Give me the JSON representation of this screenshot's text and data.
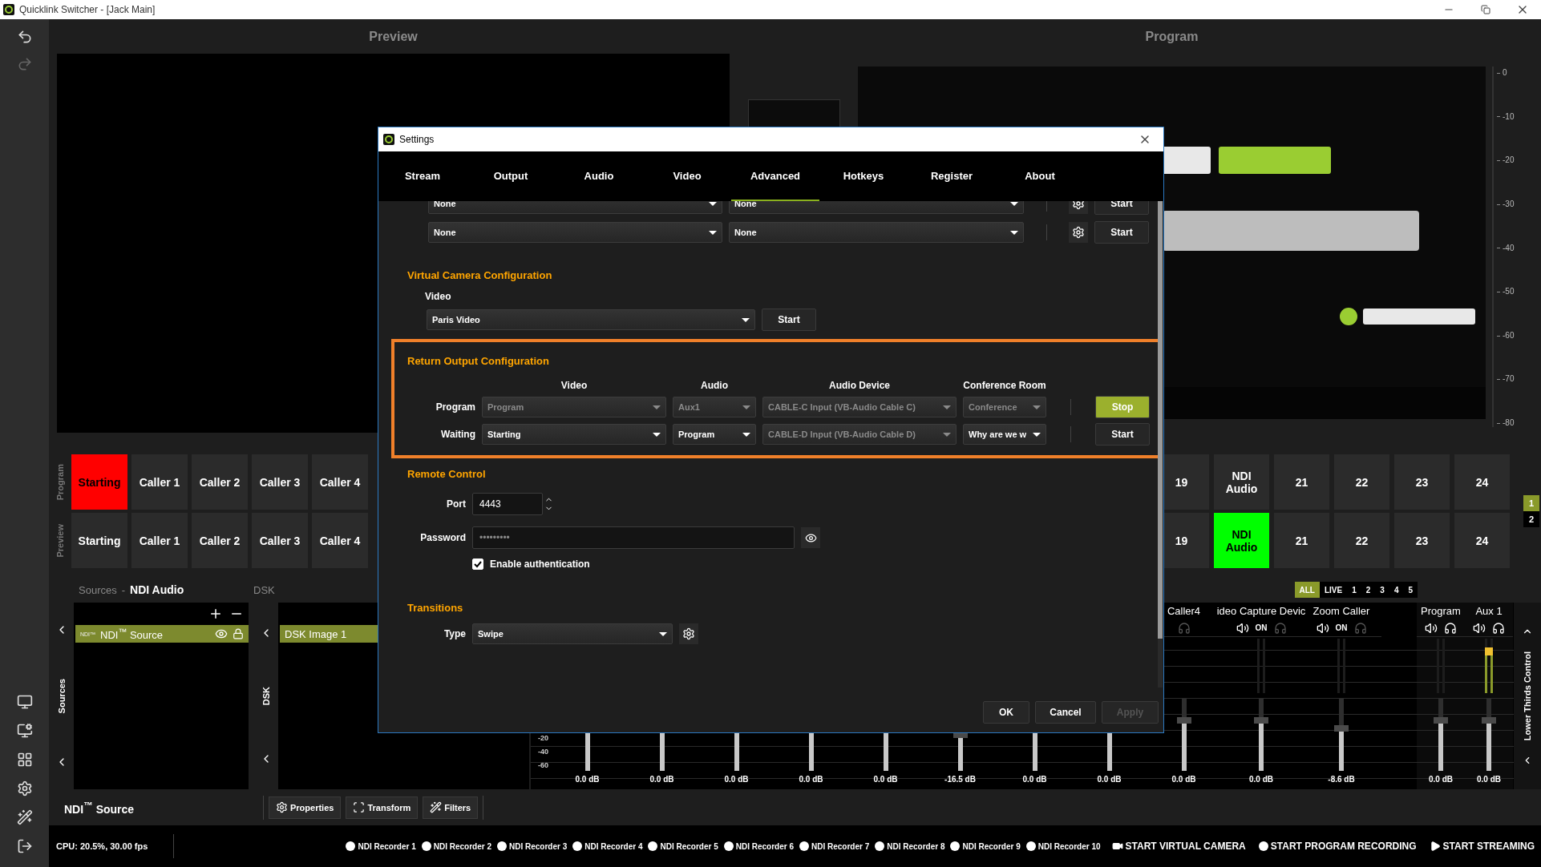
{
  "window": {
    "title": "Quicklink Switcher - [Jack Main]"
  },
  "sidebar": {
    "top": [
      {
        "kind": "undo",
        "disabled": false
      },
      {
        "kind": "redo",
        "disabled": true
      }
    ],
    "bottom": [
      {
        "kind": "display"
      },
      {
        "kind": "display-search"
      },
      {
        "kind": "layout"
      },
      {
        "kind": "settings"
      },
      {
        "kind": "tools"
      },
      {
        "kind": "exit"
      }
    ]
  },
  "monitors": {
    "preview": {
      "title": "Preview"
    },
    "program": {
      "title": "Program",
      "frame": {
        "kind": "picture"
      },
      "scale": [
        "0",
        "-10",
        "-20",
        "-30",
        "-40",
        "-50",
        "-60",
        "-70",
        "-80"
      ]
    }
  },
  "scenes": {
    "rows": [
      {
        "kind": "program",
        "label": "Program",
        "left": [
          {
            "label": "Starting",
            "selected": true
          },
          {
            "label": "Caller 1",
            "selected": false
          },
          {
            "label": "Caller 2",
            "selected": false
          },
          {
            "label": "Caller 3",
            "selected": false
          },
          {
            "label": "Caller 4",
            "selected": false
          }
        ],
        "right": [
          {
            "label": "19",
            "selected": false
          },
          {
            "label": "NDI Audio",
            "selected": false
          },
          {
            "label": "21",
            "selected": false
          },
          {
            "label": "22",
            "selected": false
          },
          {
            "label": "23",
            "selected": false
          },
          {
            "label": "24",
            "selected": false
          }
        ]
      },
      {
        "kind": "preview",
        "label": "Preview",
        "left": [
          {
            "label": "Starting",
            "selected": false
          },
          {
            "label": "Caller 1",
            "selected": false
          },
          {
            "label": "Caller 2",
            "selected": false
          },
          {
            "label": "Caller 3",
            "selected": false
          },
          {
            "label": "Caller 4",
            "selected": false
          }
        ],
        "right": [
          {
            "label": "19",
            "selected": false
          },
          {
            "label": "NDI Audio",
            "selected": true
          },
          {
            "label": "21",
            "selected": false
          },
          {
            "label": "22",
            "selected": false
          },
          {
            "label": "23",
            "selected": false
          },
          {
            "label": "24",
            "selected": false
          }
        ]
      }
    ],
    "pages": [
      {
        "label": "1",
        "selected": true
      },
      {
        "label": "2",
        "selected": false
      }
    ]
  },
  "sources": {
    "header": "Sources",
    "separator": "-",
    "current": "NDI Audio",
    "tab": "Sources",
    "items": [
      {
        "badge": "NDI™",
        "label": "NDI$^{™}$ Source",
        "selected": true
      }
    ]
  },
  "dsk": {
    "header": "DSK",
    "tab": "DSK",
    "items": [
      {
        "label": "DSK Image 1",
        "selected": true
      }
    ]
  },
  "mixer": {
    "filters": [
      {
        "label": "ALL",
        "selected": true
      },
      {
        "label": "LIVE",
        "selected": false
      },
      {
        "label": "1",
        "selected": false
      },
      {
        "label": "2",
        "selected": false
      },
      {
        "label": "3",
        "selected": false
      },
      {
        "label": "4",
        "selected": false
      },
      {
        "label": "5",
        "selected": false
      }
    ],
    "scale": [
      "-20",
      "-40",
      "-60"
    ],
    "channels": [
      {
        "reading": "0.0 dB",
        "fader": {
          "level": 0.74
        }
      },
      {
        "reading": "0.0 dB",
        "fader": {
          "level": 0.74
        }
      },
      {
        "reading": "0.0 dB",
        "fader": {
          "level": 0.74
        }
      },
      {
        "reading": "0.0 dB",
        "fader": {
          "level": 0.74
        }
      },
      {
        "reading": "0.0 dB",
        "fader": {
          "level": 0.74
        }
      },
      {
        "reading": "-16.5 dB",
        "fader": {
          "level": 0.55
        }
      },
      {
        "reading": "0.0 dB",
        "fader": {
          "level": 0.74
        }
      },
      {
        "reading": "0.0 dB",
        "fader": {
          "level": 0.74
        }
      },
      {
        "name": "Caller4",
        "controls": [
          {
            "kind": "headphones",
            "on": false
          }
        ],
        "reading": "0.0 dB",
        "fader": {
          "level": 0.74
        }
      },
      {
        "name": "ideo Capture Devic",
        "controls": [
          {
            "kind": "speaker"
          },
          {
            "kind": "status",
            "label": "ON"
          },
          {
            "kind": "headphones",
            "on": false
          }
        ],
        "reading": "0.0 dB",
        "fader": {
          "level": 0.74
        }
      },
      {
        "name": "Zoom Caller",
        "controls": [
          {
            "kind": "speaker"
          },
          {
            "kind": "status",
            "label": "ON"
          },
          {
            "kind": "headphones",
            "on": false
          }
        ],
        "reading": "-8.6 dB",
        "fader": {
          "level": 0.63
        }
      }
    ],
    "masters": [
      {
        "name": "Program",
        "controls": [
          {
            "kind": "speaker"
          },
          {
            "kind": "headphones",
            "on": true
          }
        ],
        "reading": "0.0 dB",
        "fader": {
          "level": 0.74
        }
      },
      {
        "name": "Aux 1",
        "controls": [
          {
            "kind": "speaker"
          },
          {
            "kind": "headphones",
            "on": true
          }
        ],
        "meter": {
          "level": 0.84
        },
        "reading": "0.0 dB",
        "fader": {
          "level": 0.74
        }
      }
    ]
  },
  "lower_thirds": {
    "label": "Lower Thirds Control"
  },
  "source_toolbar": {
    "source": "NDI$^{™}$ Source",
    "buttons": [
      {
        "label": "Properties",
        "kind": "gear"
      },
      {
        "label": "Transform",
        "kind": "transform"
      },
      {
        "label": "Filters",
        "kind": "wand"
      }
    ]
  },
  "status_bar": {
    "cpu": "CPU: 20.5%, 30.00 fps",
    "recorders": [
      "NDI Recorder 1",
      "NDI Recorder 2",
      "NDI Recorder 3",
      "NDI Recorder 4",
      "NDI Recorder 5",
      "NDI Recorder 6",
      "NDI Recorder 7",
      "NDI Recorder 8",
      "NDI Recorder 9",
      "NDI Recorder 10"
    ],
    "actions": [
      {
        "label": "START VIRTUAL CAMERA",
        "kind": "camera"
      },
      {
        "label": "START PROGRAM RECORDING",
        "kind": "record"
      },
      {
        "label": "START STREAMING",
        "kind": "stream"
      }
    ]
  },
  "settings": {
    "title": "Settings",
    "tabs": [
      {
        "label": "Stream",
        "selected": false
      },
      {
        "label": "Output",
        "selected": false
      },
      {
        "label": "Audio",
        "selected": false
      },
      {
        "label": "Video",
        "selected": false
      },
      {
        "label": "Advanced",
        "selected": true
      },
      {
        "label": "Hotkeys",
        "selected": false
      },
      {
        "label": "Register",
        "selected": false
      },
      {
        "label": "About",
        "selected": false
      }
    ],
    "output_rows": [
      {
        "source": "None",
        "target": "None",
        "button": "Start"
      },
      {
        "source": "None",
        "target": "None",
        "button": "Start"
      }
    ],
    "virtual_camera": {
      "heading": "Virtual Camera Configuration",
      "label": "Video",
      "value": "Paris Video",
      "button": "Start"
    },
    "return_output": {
      "heading": "Return Output Configuration",
      "highlighted": true,
      "columns": [
        "Video",
        "Audio",
        "Audio Device",
        "Conference Room"
      ],
      "rows": [
        {
          "label": "Program",
          "cells": [
            {
              "value": "Program",
              "disabled": true
            },
            {
              "value": "Aux1",
              "disabled": true
            },
            {
              "value": "CABLE-C Input (VB-Audio Cable C)",
              "disabled": true
            },
            {
              "value": "Conference",
              "disabled": true
            }
          ],
          "button": {
            "label": "Stop",
            "active": true
          }
        },
        {
          "label": "Waiting",
          "cells": [
            {
              "value": "Starting",
              "disabled": false
            },
            {
              "value": "Program",
              "disabled": false
            },
            {
              "value": "CABLE-D Input (VB-Audio Cable D)",
              "disabled": true
            },
            {
              "value": "Why are we w",
              "disabled": false
            }
          ],
          "button": {
            "label": "Start",
            "active": false
          }
        }
      ]
    },
    "remote_control": {
      "heading": "Remote Control",
      "port_label": "Port",
      "port": "4443",
      "password_label": "Password",
      "password": "•••••••••",
      "auth": {
        "label": "Enable authentication",
        "checked": true
      }
    },
    "transitions": {
      "heading": "Transitions",
      "type_label": "Type",
      "type": "Swipe"
    },
    "buttons": [
      {
        "label": "OK",
        "disabled": false
      },
      {
        "label": "Cancel",
        "disabled": false
      },
      {
        "label": "Apply",
        "disabled": true
      }
    ]
  }
}
